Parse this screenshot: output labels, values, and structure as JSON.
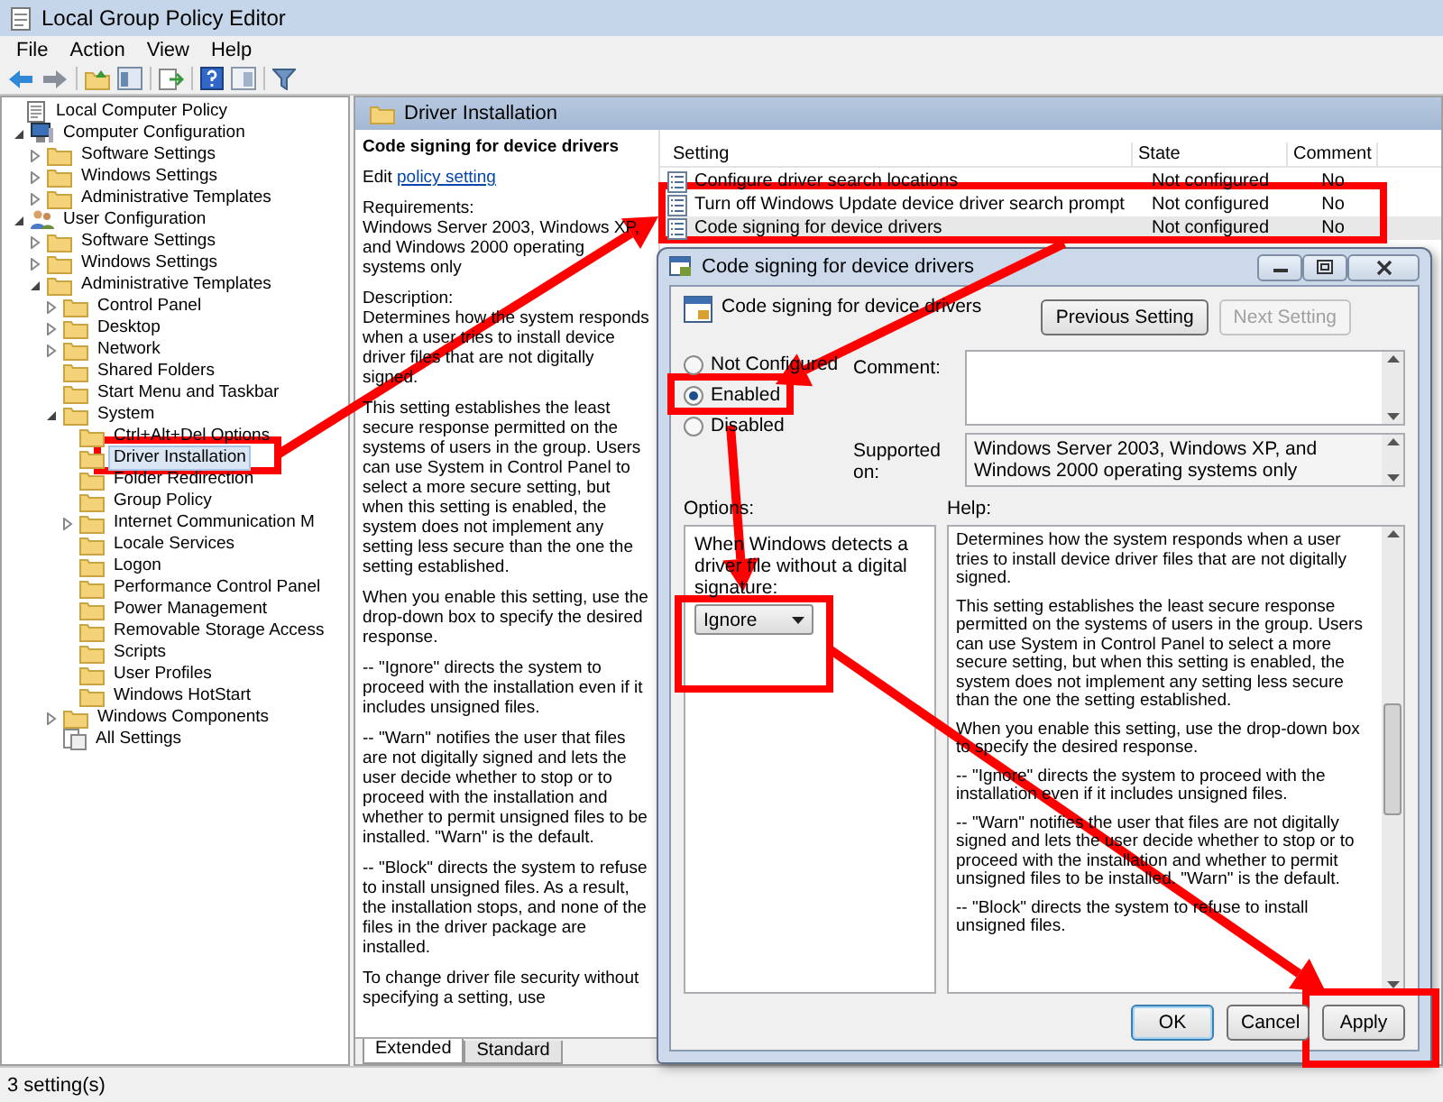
{
  "window": {
    "title": "Local Group Policy Editor"
  },
  "menu": [
    "File",
    "Action",
    "View",
    "Help"
  ],
  "tree": [
    {
      "label": "Local Computer Policy",
      "kind": "root",
      "expandable": false,
      "selected": false,
      "children": [
        {
          "label": "Computer Configuration",
          "kind": "computer",
          "expandable": true,
          "expanded": true,
          "selected": false,
          "children": [
            {
              "label": "Software Settings",
              "kind": "folder",
              "expandable": true,
              "expanded": false,
              "selected": false
            },
            {
              "label": "Windows Settings",
              "kind": "folder",
              "expandable": true,
              "expanded": false,
              "selected": false
            },
            {
              "label": "Administrative Templates",
              "kind": "folder",
              "expandable": true,
              "expanded": false,
              "selected": false
            }
          ]
        },
        {
          "label": "User Configuration",
          "kind": "user",
          "expandable": true,
          "expanded": true,
          "selected": false,
          "children": [
            {
              "label": "Software Settings",
              "kind": "folder",
              "expandable": true,
              "expanded": false,
              "selected": false
            },
            {
              "label": "Windows Settings",
              "kind": "folder",
              "expandable": true,
              "expanded": false,
              "selected": false
            },
            {
              "label": "Administrative Templates",
              "kind": "folder",
              "expandable": true,
              "expanded": true,
              "selected": false,
              "children": [
                {
                  "label": "Control Panel",
                  "kind": "folder",
                  "expandable": true,
                  "expanded": false,
                  "selected": false
                },
                {
                  "label": "Desktop",
                  "kind": "folder",
                  "expandable": true,
                  "expanded": false,
                  "selected": false
                },
                {
                  "label": "Network",
                  "kind": "folder",
                  "expandable": true,
                  "expanded": false,
                  "selected": false
                },
                {
                  "label": "Shared Folders",
                  "kind": "folder",
                  "expandable": false,
                  "selected": false
                },
                {
                  "label": "Start Menu and Taskbar",
                  "kind": "folder",
                  "expandable": false,
                  "selected": false
                },
                {
                  "label": "System",
                  "kind": "folder",
                  "expandable": true,
                  "expanded": true,
                  "selected": false,
                  "children": [
                    {
                      "label": "Ctrl+Alt+Del Options",
                      "kind": "folder",
                      "expandable": false,
                      "selected": false
                    },
                    {
                      "label": "Driver Installation",
                      "kind": "folder",
                      "expandable": false,
                      "selected": true
                    },
                    {
                      "label": "Folder Redirection",
                      "kind": "folder",
                      "expandable": false,
                      "selected": false
                    },
                    {
                      "label": "Group Policy",
                      "kind": "folder",
                      "expandable": false,
                      "selected": false
                    },
                    {
                      "label": "Internet Communication M",
                      "kind": "folder",
                      "expandable": true,
                      "expanded": false,
                      "selected": false
                    },
                    {
                      "label": "Locale Services",
                      "kind": "folder",
                      "expandable": false,
                      "selected": false
                    },
                    {
                      "label": "Logon",
                      "kind": "folder",
                      "expandable": false,
                      "selected": false
                    },
                    {
                      "label": "Performance Control Panel",
                      "kind": "folder",
                      "expandable": false,
                      "selected": false
                    },
                    {
                      "label": "Power Management",
                      "kind": "folder",
                      "expandable": false,
                      "selected": false
                    },
                    {
                      "label": "Removable Storage Access",
                      "kind": "folder",
                      "expandable": false,
                      "selected": false
                    },
                    {
                      "label": "Scripts",
                      "kind": "folder",
                      "expandable": false,
                      "selected": false
                    },
                    {
                      "label": "User Profiles",
                      "kind": "folder",
                      "expandable": false,
                      "selected": false
                    },
                    {
                      "label": "Windows HotStart",
                      "kind": "folder",
                      "expandable": false,
                      "selected": false
                    }
                  ]
                },
                {
                  "label": "Windows Components",
                  "kind": "folder",
                  "expandable": true,
                  "expanded": false,
                  "selected": false
                },
                {
                  "label": "All Settings",
                  "kind": "all",
                  "expandable": false,
                  "selected": false
                }
              ]
            }
          ]
        }
      ]
    }
  ],
  "header": {
    "title": "Driver Installation"
  },
  "description": {
    "title": "Code signing for device drivers",
    "edit_prefix": "Edit",
    "edit_link": "policy setting",
    "requirements_label": "Requirements:",
    "requirements": "Windows Server 2003, Windows XP, and Windows 2000 operating systems only",
    "description_label": "Description:",
    "paragraphs": [
      "Determines how the system responds when a user tries to install device driver files that are not digitally signed.",
      "This setting establishes the least secure response permitted on the systems of users in the group. Users can use System in Control Panel to select a more secure setting, but when this setting is enabled, the system does not implement any setting less secure than the one the setting established.",
      "When you enable this setting, use the drop-down box to specify the desired response.",
      "--   \"Ignore\" directs the system to proceed with the installation even if it includes unsigned files.",
      "--   \"Warn\" notifies the user that files are not digitally signed and lets the user decide whether to stop or to proceed with the installation and whether to permit unsigned files to be installed. \"Warn\" is the default.",
      "--   \"Block\" directs the system to refuse to install unsigned files. As a result, the installation stops, and none of the files in the driver package are installed.",
      "To change driver file security without specifying a setting, use"
    ]
  },
  "list": {
    "columns": [
      "Setting",
      "State",
      "Comment"
    ],
    "rows": [
      {
        "setting": "Configure driver search locations",
        "state": "Not configured",
        "comment": "No",
        "selected": false
      },
      {
        "setting": "Turn off Windows Update device driver search prompt",
        "state": "Not configured",
        "comment": "No",
        "selected": false
      },
      {
        "setting": "Code signing for device drivers",
        "state": "Not configured",
        "comment": "No",
        "selected": true
      }
    ]
  },
  "tabs": [
    {
      "label": "Extended",
      "selected": true
    },
    {
      "label": "Standard",
      "selected": false
    }
  ],
  "status_bar": "3 setting(s)",
  "dialog": {
    "title": "Code signing for device drivers",
    "heading": "Code signing for device drivers",
    "nav_buttons": [
      {
        "label": "Previous Setting",
        "disabled": false
      },
      {
        "label": "Next Setting",
        "disabled": true
      }
    ],
    "states": [
      {
        "label": "Not Configured",
        "selected": false
      },
      {
        "label": "Enabled",
        "selected": true
      },
      {
        "label": "Disabled",
        "selected": false
      }
    ],
    "comment_label": "Comment:",
    "supported_label": "Supported on:",
    "supported_value": "Windows Server 2003, Windows XP, and Windows 2000 operating systems only",
    "options_label": "Options:",
    "help_label": "Help:",
    "option_prompt": "When Windows detects a driver file without a digital signature:",
    "option_value": "Ignore",
    "help": [
      "Determines how the system responds when a user tries to install device driver files that are not digitally signed.",
      "This setting establishes the least secure response permitted on the systems of users in the group. Users can use System in Control Panel to select a more secure setting, but when this setting is enabled, the system does not implement any setting less secure than the one the setting established.",
      "When you enable this setting, use the drop-down box to specify the desired response.",
      "--   \"Ignore\" directs the system to proceed with the installation even if it includes unsigned files.",
      "--   \"Warn\" notifies the user that files are not digitally signed and lets the user decide whether to stop or to proceed with the installation and whether to permit unsigned files to be installed. \"Warn\" is the default.",
      "--   \"Block\" directs the system to refuse to install unsigned files."
    ],
    "buttons": [
      {
        "label": "OK",
        "default": true
      },
      {
        "label": "Cancel",
        "default": false
      },
      {
        "label": "Apply",
        "default": false
      }
    ]
  }
}
